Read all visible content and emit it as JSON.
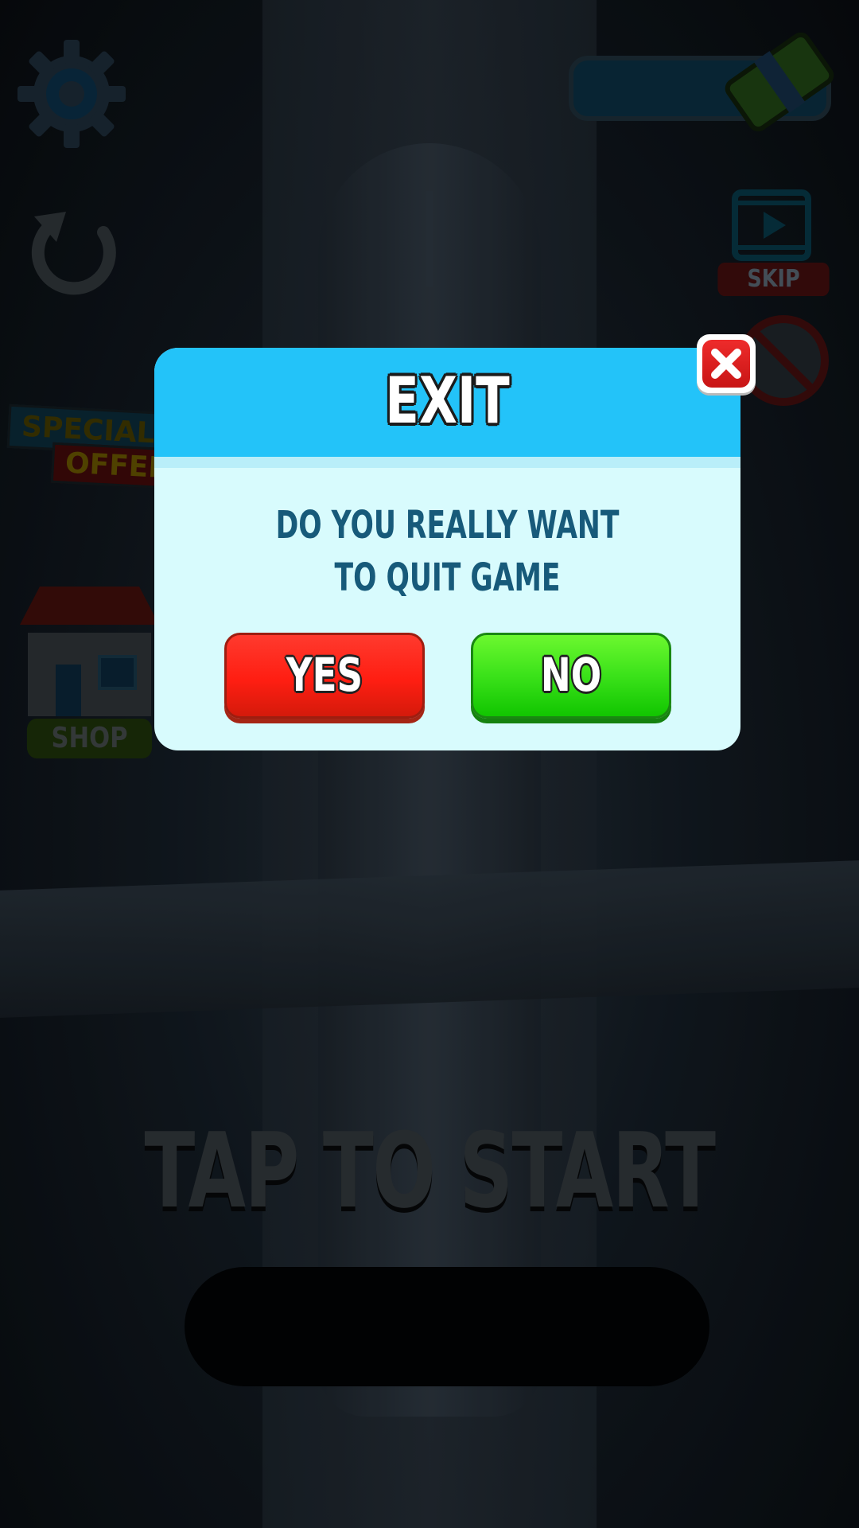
{
  "background": {
    "tap_to_start": "TAP TO START",
    "skip_label": "SKIP",
    "shop_label": "SHOP",
    "special_offer_line1": "SPECIAL",
    "special_offer_line2": "OFFER",
    "icons": [
      "gear-icon",
      "reload-icon",
      "money-icon",
      "skip-film-icon",
      "no-ads-icon",
      "shop-icon"
    ]
  },
  "dialog": {
    "title": "EXIT",
    "message_line1": "DO YOU REALLY WANT",
    "message_line2": "TO QUIT GAME",
    "yes_label": "YES",
    "no_label": "NO",
    "close_icon": "close-icon"
  },
  "colors": {
    "header": "#23c3f9",
    "body": "#d8fbfd",
    "message": "#175a7a",
    "yes": "#ff1e12",
    "no": "#3be21a",
    "close": "#c81515"
  }
}
